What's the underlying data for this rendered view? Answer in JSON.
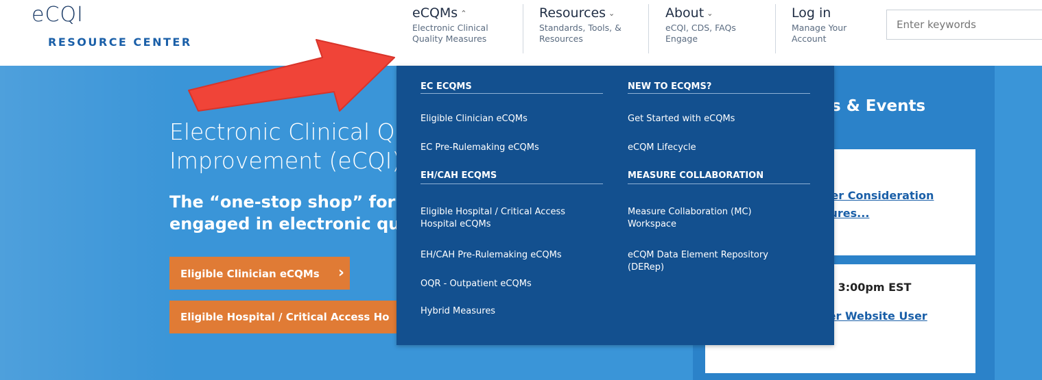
{
  "header": {
    "logo_line1": "eCQI",
    "logo_line2": "RESOURCE CENTER",
    "nav": [
      {
        "title": "eCQMs",
        "sub1": "Electronic Clinical",
        "sub2": "Quality Measures"
      },
      {
        "title": "Resources",
        "sub1": "Standards, Tools, &",
        "sub2": "Resources"
      },
      {
        "title": "About",
        "sub1": "eCQI, CDS, FAQs",
        "sub2": "Engage"
      },
      {
        "title": "Log in",
        "sub1": "Manage Your",
        "sub2": "Account"
      }
    ],
    "search_placeholder": "Enter keywords"
  },
  "hero": {
    "title_line1": "Electronic Clinical Q",
    "title_line2": "Improvement (eCQI)",
    "sub_line1": "The “one-stop shop” for",
    "sub_line2": "engaged in electronic qu",
    "cta1": "Eligible Clinician eCQMs",
    "cta1_chevron": "›",
    "cta2": "Eligible Hospital / Critical Access Ho"
  },
  "news": {
    "title": "s & Events",
    "link1_line1": "der Consideration",
    "link1_line2": "sures...",
    "time": "@ 3:00pm EST",
    "link2": "ter Website User"
  },
  "dropdown": {
    "col1": {
      "section1_heading": "EC ECQMS",
      "section1_links": [
        "Eligible Clinician eCQMs",
        "EC Pre-Rulemaking eCQMs"
      ],
      "section2_heading": "EH/CAH ECQMS",
      "section2_links": [
        "Eligible Hospital / Critical Access Hospital eCQMs",
        "EH/CAH Pre-Rulemaking eCQMs",
        "OQR - Outpatient eCQMs",
        "Hybrid Measures"
      ]
    },
    "col2": {
      "section1_heading": "NEW TO ECQMS?",
      "section1_links": [
        "Get Started with eCQMs",
        "eCQM Lifecycle"
      ],
      "section2_heading": "MEASURE COLLABORATION",
      "section2_links": [
        "Measure Collaboration (MC) Workspace",
        "eCQM Data Element Repository (DERep)"
      ]
    }
  },
  "colors": {
    "hero_blue": "#3a95d8",
    "dropdown_navy": "#13508f",
    "cta_orange": "#e07b35",
    "arrow_red": "#f04438"
  }
}
